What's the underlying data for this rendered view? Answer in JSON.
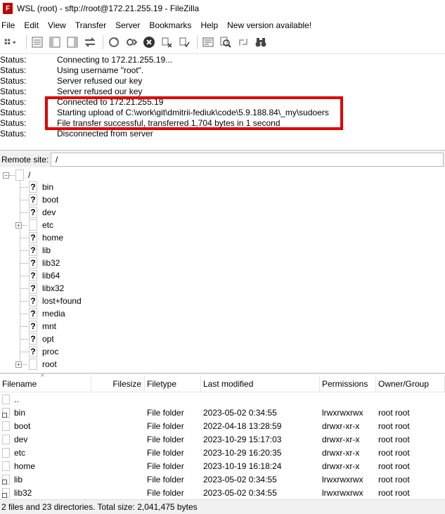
{
  "window": {
    "title": "WSL (root) - sftp://root@172.21.255.19 - FileZilla",
    "app_icon_letter": "F"
  },
  "menu": [
    "File",
    "Edit",
    "View",
    "Transfer",
    "Server",
    "Bookmarks",
    "Help",
    "New version available!"
  ],
  "log": [
    {
      "kind": "Status:",
      "text": "Connecting to 172.21.255.19..."
    },
    {
      "kind": "Status:",
      "text": "Using username \"root\"."
    },
    {
      "kind": "Status:",
      "text": "Server refused our key"
    },
    {
      "kind": "Status:",
      "text": "Server refused our key"
    },
    {
      "kind": "Status:",
      "text": "Connected to 172.21.255.19"
    },
    {
      "kind": "Status:",
      "text": "Starting upload of C:\\work\\git\\dmitrii-fediuk\\code\\5.9.188.84\\_my\\sudoers"
    },
    {
      "kind": "Status:",
      "text": "File transfer successful, transferred 1,704 bytes in 1 second"
    },
    {
      "kind": "Status:",
      "text": "Disconnected from server"
    }
  ],
  "remote": {
    "label": "Remote site:",
    "path": "/"
  },
  "tree": {
    "root_label": "/",
    "items": [
      {
        "name": "bin",
        "icon": "?",
        "expandable": false
      },
      {
        "name": "boot",
        "icon": "?",
        "expandable": false
      },
      {
        "name": "dev",
        "icon": "?",
        "expandable": false
      },
      {
        "name": "etc",
        "icon": "",
        "expandable": true
      },
      {
        "name": "home",
        "icon": "?",
        "expandable": false
      },
      {
        "name": "lib",
        "icon": "?",
        "expandable": false
      },
      {
        "name": "lib32",
        "icon": "?",
        "expandable": false
      },
      {
        "name": "lib64",
        "icon": "?",
        "expandable": false
      },
      {
        "name": "libx32",
        "icon": "?",
        "expandable": false
      },
      {
        "name": "lost+found",
        "icon": "?",
        "expandable": false
      },
      {
        "name": "media",
        "icon": "?",
        "expandable": false
      },
      {
        "name": "mnt",
        "icon": "?",
        "expandable": false
      },
      {
        "name": "opt",
        "icon": "?",
        "expandable": false
      },
      {
        "name": "proc",
        "icon": "?",
        "expandable": false
      },
      {
        "name": "root",
        "icon": "",
        "expandable": true
      }
    ]
  },
  "files": {
    "columns": [
      "Filename",
      "Filesize",
      "Filetype",
      "Last modified",
      "Permissions",
      "Owner/Group"
    ],
    "rows": [
      {
        "name": "..",
        "size": "",
        "type": "",
        "modified": "",
        "perms": "",
        "owner": "",
        "link": false
      },
      {
        "name": "bin",
        "size": "",
        "type": "File folder",
        "modified": "2023-05-02 0:34:55",
        "perms": "lrwxrwxrwx",
        "owner": "root root",
        "link": true
      },
      {
        "name": "boot",
        "size": "",
        "type": "File folder",
        "modified": "2022-04-18 13:28:59",
        "perms": "drwxr-xr-x",
        "owner": "root root",
        "link": false
      },
      {
        "name": "dev",
        "size": "",
        "type": "File folder",
        "modified": "2023-10-29 15:17:03",
        "perms": "drwxr-xr-x",
        "owner": "root root",
        "link": false
      },
      {
        "name": "etc",
        "size": "",
        "type": "File folder",
        "modified": "2023-10-29 16:20:35",
        "perms": "drwxr-xr-x",
        "owner": "root root",
        "link": false
      },
      {
        "name": "home",
        "size": "",
        "type": "File folder",
        "modified": "2023-10-19 16:18:24",
        "perms": "drwxr-xr-x",
        "owner": "root root",
        "link": false
      },
      {
        "name": "lib",
        "size": "",
        "type": "File folder",
        "modified": "2023-05-02 0:34:55",
        "perms": "lrwxrwxrwx",
        "owner": "root root",
        "link": true
      },
      {
        "name": "lib32",
        "size": "",
        "type": "File folder",
        "modified": "2023-05-02 0:34:55",
        "perms": "lrwxrwxrwx",
        "owner": "root root",
        "link": true
      }
    ]
  },
  "status": {
    "text": "2 files and 23 directories. Total size: 2,041,475 bytes"
  },
  "colors": {
    "highlight": "#e00000",
    "app_icon": "#bf0000"
  }
}
